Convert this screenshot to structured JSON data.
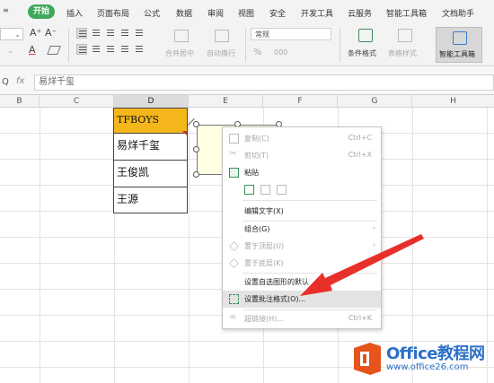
{
  "menu": {
    "more": "≡",
    "tabs": [
      "开始",
      "插入",
      "页面布局",
      "公式",
      "数据",
      "审阅",
      "视图",
      "安全",
      "开发工具",
      "云服务",
      "智能工具箱",
      "文档助手"
    ],
    "active_tab": "开始"
  },
  "ribbon": {
    "font_size_value": "",
    "grow_font": "A⁺",
    "shrink_font": "A⁻",
    "font_color_label": "A",
    "number_format": "常规",
    "merge_center": "合并居中",
    "wrap_text": "自动换行",
    "percent": "%",
    "thousands": "000",
    "conditional_format": "条件格式",
    "table_style": "表格样式",
    "ai_toolbox": "智能工具箱"
  },
  "formula_bar": {
    "cell_ref": "Q",
    "fx": "fx",
    "content": "易烊千玺"
  },
  "columns": [
    "B",
    "C",
    "D",
    "E",
    "F",
    "G",
    "H"
  ],
  "selected_column": "D",
  "cells": [
    {
      "ref": "D1",
      "value": "TFBOYS"
    },
    {
      "ref": "D2",
      "value": "易烊千玺"
    },
    {
      "ref": "D3",
      "value": "王俊凯"
    },
    {
      "ref": "D4",
      "value": "王源"
    }
  ],
  "context_menu": {
    "items": [
      {
        "label": "复制(C)",
        "shortcut": "Ctrl+C",
        "enabled": false
      },
      {
        "label": "剪切(T)",
        "shortcut": "Ctrl+X",
        "enabled": false
      },
      {
        "label": "粘贴",
        "shortcut": "",
        "enabled": true
      },
      {
        "label": "编辑文字(X)",
        "shortcut": "",
        "enabled": true
      },
      {
        "label": "组合(G)",
        "shortcut": "",
        "enabled": true
      },
      {
        "label": "置于顶层(U)",
        "shortcut": "",
        "enabled": false
      },
      {
        "label": "置于底层(K)",
        "shortcut": "",
        "enabled": false
      },
      {
        "label": "设置自选图形的默认",
        "shortcut": "",
        "enabled": true
      },
      {
        "label": "设置批注格式(O)...",
        "shortcut": "",
        "enabled": true
      },
      {
        "label": "超链接(H)...",
        "shortcut": "Ctrl+K",
        "enabled": false
      }
    ],
    "submenu_arrow": "›"
  },
  "watermark": {
    "title": "Office教程网",
    "url": "www.office26.com"
  },
  "colors": {
    "active_tab": "#3fa85b",
    "header_cell": "#f4b61a",
    "comment_bg": "#ffffe3",
    "arrow": "#e8302a",
    "watermark": "#2b6fc7",
    "logo": "#e6541c"
  }
}
